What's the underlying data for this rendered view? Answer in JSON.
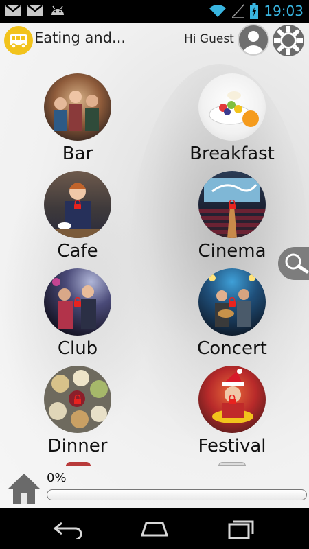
{
  "status_bar": {
    "time": "19:03",
    "icons": [
      "gmail-icon",
      "gmail-icon",
      "android-icon",
      "wifi-icon",
      "signal-icon",
      "battery-charging-icon"
    ]
  },
  "header": {
    "title": "Eating and...",
    "greeting": "Hi Guest",
    "icons": [
      "bus-icon",
      "avatar-icon",
      "settings-icon"
    ]
  },
  "categories": [
    {
      "label": "Bar",
      "locked": false
    },
    {
      "label": "Breakfast",
      "locked": false
    },
    {
      "label": "Cafe",
      "locked": true
    },
    {
      "label": "Cinema",
      "locked": true
    },
    {
      "label": "Club",
      "locked": true
    },
    {
      "label": "Concert",
      "locked": true
    },
    {
      "label": "Dinner",
      "locked": true
    },
    {
      "label": "Festival",
      "locked": true
    }
  ],
  "progress": {
    "text": "0%",
    "value": 0
  },
  "colors": {
    "accent": "#39b5e0",
    "bus": "#f2c31c",
    "lock": "#e8231f"
  },
  "nav": {
    "icons": [
      "back-icon",
      "home-icon",
      "recent-apps-icon"
    ]
  }
}
